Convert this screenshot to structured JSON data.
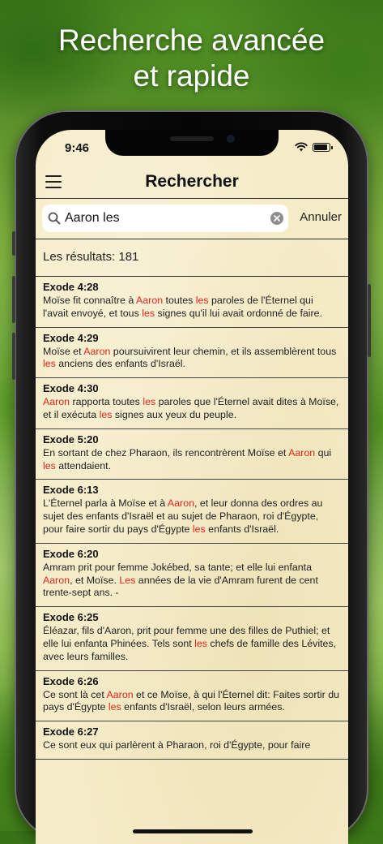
{
  "headline": {
    "line1": "Recherche avancée",
    "line2": "et rapide"
  },
  "status_bar": {
    "time": "9:46"
  },
  "navbar": {
    "title": "Rechercher"
  },
  "search": {
    "value": "Aaron les",
    "cancel_label": "Annuler"
  },
  "results_count": "Les résultats: 181",
  "highlight_color": "#e0261b",
  "results": [
    {
      "ref": "Exode 4:28",
      "segments": [
        {
          "t": "Moïse fit connaître à "
        },
        {
          "t": "Aaron",
          "hl": true
        },
        {
          "t": " toutes "
        },
        {
          "t": "les",
          "hl": true
        },
        {
          "t": " paroles de l'Éternel qui l'avait envoyé, et tous "
        },
        {
          "t": "les",
          "hl": true
        },
        {
          "t": " signes qu'il lui avait ordonné de faire."
        }
      ]
    },
    {
      "ref": "Exode 4:29",
      "segments": [
        {
          "t": "Moïse et "
        },
        {
          "t": "Aaron",
          "hl": true
        },
        {
          "t": " poursuivirent leur chemin, et ils assemblèrent tous "
        },
        {
          "t": "les",
          "hl": true
        },
        {
          "t": " anciens des enfants d'Israël."
        }
      ]
    },
    {
      "ref": "Exode 4:30",
      "segments": [
        {
          "t": "Aaron",
          "hl": true
        },
        {
          "t": " rapporta toutes "
        },
        {
          "t": "les",
          "hl": true
        },
        {
          "t": " paroles que l'Éternel avait dites à Moïse, et il exécuta "
        },
        {
          "t": "les",
          "hl": true
        },
        {
          "t": " signes aux yeux du peuple."
        }
      ]
    },
    {
      "ref": "Exode 5:20",
      "segments": [
        {
          "t": "En sortant de chez Pharaon, ils rencontrèrent Moïse et "
        },
        {
          "t": "Aaron",
          "hl": true
        },
        {
          "t": " qui "
        },
        {
          "t": "les",
          "hl": true
        },
        {
          "t": " attendaient."
        }
      ]
    },
    {
      "ref": "Exode 6:13",
      "segments": [
        {
          "t": "L'Éternel parla à Moïse et à "
        },
        {
          "t": "Aaron",
          "hl": true
        },
        {
          "t": ", et leur donna des ordres au sujet des enfants d'Israël et au sujet de Pharaon, roi d'Égypte, pour faire sortir du pays d'Égypte "
        },
        {
          "t": "les",
          "hl": true
        },
        {
          "t": " enfants d'Israël."
        }
      ]
    },
    {
      "ref": "Exode 6:20",
      "segments": [
        {
          "t": "Amram prit pour femme Jokébed, sa tante; et elle lui enfanta "
        },
        {
          "t": "Aaron",
          "hl": true
        },
        {
          "t": ", et Moïse. "
        },
        {
          "t": "Les",
          "hl": true
        },
        {
          "t": " années de la vie d'Amram furent de cent trente-sept ans. -"
        }
      ]
    },
    {
      "ref": "Exode 6:25",
      "segments": [
        {
          "t": "Éléazar, fils d'Aaron, prit pour femme une des filles de Puthiel; et elle lui enfanta Phinées. Tels sont "
        },
        {
          "t": "les",
          "hl": true
        },
        {
          "t": " chefs de famille des Lévites, avec leurs familles."
        }
      ]
    },
    {
      "ref": "Exode 6:26",
      "segments": [
        {
          "t": "Ce sont là cet "
        },
        {
          "t": "Aaron",
          "hl": true
        },
        {
          "t": " et ce Moïse, à qui l'Éternel dit: Faites sortir du pays d'Égypte "
        },
        {
          "t": "les",
          "hl": true
        },
        {
          "t": " enfants d'Israël, selon leurs armées."
        }
      ]
    },
    {
      "ref": "Exode 6:27",
      "segments": [
        {
          "t": "Ce sont eux qui parlèrent à Pharaon, roi d'Égypte, pour faire"
        }
      ]
    }
  ]
}
